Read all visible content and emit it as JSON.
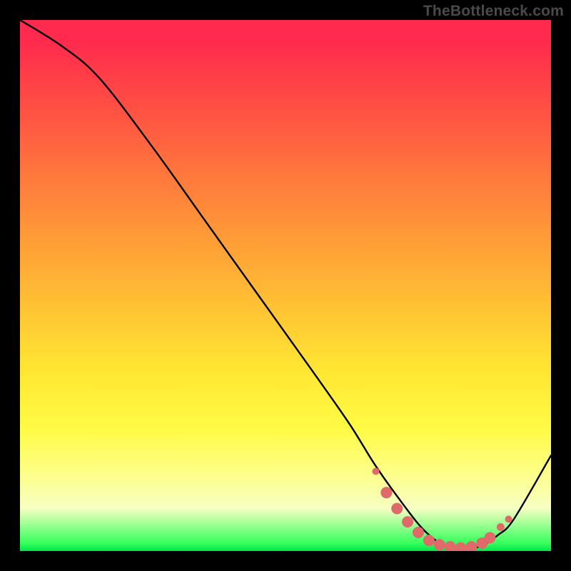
{
  "watermark": "TheBottleneck.com",
  "chart_data": {
    "type": "line",
    "title": "",
    "xlabel": "",
    "ylabel": "",
    "xlim": [
      0,
      100
    ],
    "ylim": [
      0,
      100
    ],
    "series": [
      {
        "name": "main-curve",
        "x": [
          0,
          8,
          15,
          25,
          35,
          45,
          55,
          62,
          67,
          72,
          76,
          80,
          84,
          87,
          90,
          93,
          100
        ],
        "y": [
          100,
          95,
          89,
          76,
          62,
          48,
          34,
          24,
          16,
          9,
          4,
          1,
          0.5,
          1,
          3,
          6,
          18
        ]
      }
    ],
    "markers": {
      "name": "highlight-dots",
      "color": "#e06a6a",
      "points": [
        {
          "x": 67,
          "y": 15
        },
        {
          "x": 69,
          "y": 11
        },
        {
          "x": 71,
          "y": 8
        },
        {
          "x": 73,
          "y": 5.5
        },
        {
          "x": 75,
          "y": 3.5
        },
        {
          "x": 77,
          "y": 2
        },
        {
          "x": 79,
          "y": 1.2
        },
        {
          "x": 81,
          "y": 0.8
        },
        {
          "x": 83,
          "y": 0.6
        },
        {
          "x": 85,
          "y": 0.8
        },
        {
          "x": 87,
          "y": 1.5
        },
        {
          "x": 88.5,
          "y": 2.5
        },
        {
          "x": 90.5,
          "y": 4.5
        },
        {
          "x": 92,
          "y": 6
        }
      ]
    },
    "background_gradient": {
      "top": "#ff2a4d",
      "mid_upper": "#ff9e37",
      "mid_lower": "#fffb45",
      "bottom": "#00e648"
    }
  }
}
